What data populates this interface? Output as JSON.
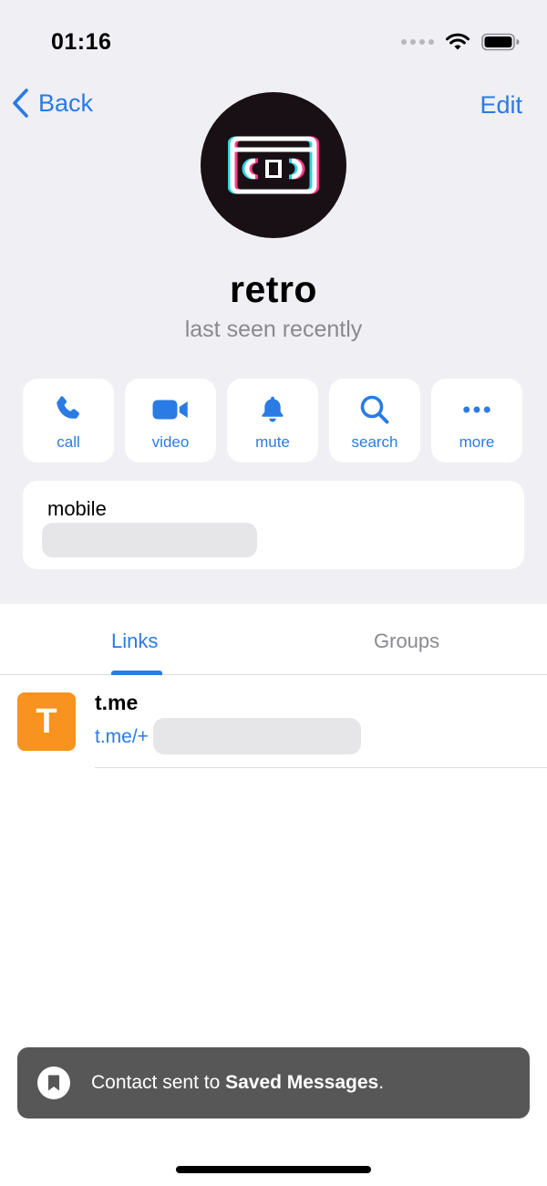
{
  "status_bar": {
    "time": "01:16"
  },
  "nav": {
    "back_label": "Back",
    "edit_label": "Edit"
  },
  "profile": {
    "name": "retro",
    "status": "last seen recently"
  },
  "actions": [
    {
      "label": "call",
      "icon": "phone-icon"
    },
    {
      "label": "video",
      "icon": "video-camera-icon"
    },
    {
      "label": "mute",
      "icon": "bell-icon"
    },
    {
      "label": "search",
      "icon": "search-icon"
    },
    {
      "label": "more",
      "icon": "more-dots-icon"
    }
  ],
  "info": {
    "mobile_label": "mobile"
  },
  "tabs": {
    "links_label": "Links",
    "groups_label": "Groups",
    "active": "Links"
  },
  "links": [
    {
      "thumb_letter": "T",
      "title": "t.me",
      "url_prefix": "t.me/+"
    }
  ],
  "toast": {
    "text_prefix": "Contact sent to ",
    "text_bold": "Saved Messages",
    "text_suffix": "."
  },
  "colors": {
    "accent": "#2a7be4",
    "background": "#efeff4",
    "thumb": "#f7931e",
    "toast": "#575757"
  }
}
